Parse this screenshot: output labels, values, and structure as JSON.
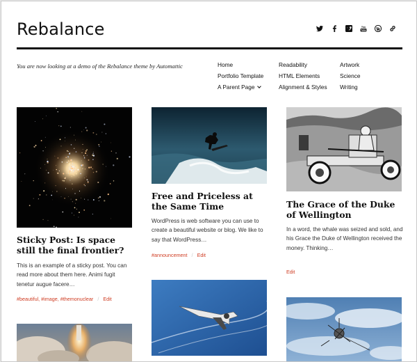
{
  "site": {
    "title": "Rebalance",
    "tagline": "You are now looking at a demo of the Rebalance theme by Automattic"
  },
  "social": [
    "twitter-icon",
    "facebook-icon",
    "vimeo-icon",
    "youtube-icon",
    "wordpress-icon",
    "link-icon"
  ],
  "menu": {
    "col1": [
      "Home",
      "Portfolio Template",
      "A Parent Page"
    ],
    "col2": [
      "Readability",
      "HTML Elements",
      "Alignment & Styles"
    ],
    "col3": [
      "Artwork",
      "Science",
      "Writing"
    ]
  },
  "posts": [
    {
      "title": "Sticky Post: Is space still the final frontier?",
      "excerpt": "This is an example of a sticky post. You can read more about them here. Animi fugit tenetur augue facere…",
      "tags": [
        "#beautiful",
        "#image",
        "#themonuclear"
      ],
      "edit": "Edit"
    },
    {
      "title": "Free and Priceless at the Same Time",
      "excerpt": "WordPress is web software you can use to create a beautiful website or blog. We like to say that WordPress…",
      "tags": [
        "#announcement"
      ],
      "edit": "Edit"
    },
    {
      "title": "The Grace of the Duke of Wellington",
      "excerpt": "In a word, the whale was seized and sold, and his Grace the Duke of Wellington received the money. Thinking…",
      "tags": [],
      "edit": "Edit"
    }
  ],
  "colors": {
    "accent": "#cf3c22",
    "text": "#111111",
    "rule": "#111111"
  }
}
